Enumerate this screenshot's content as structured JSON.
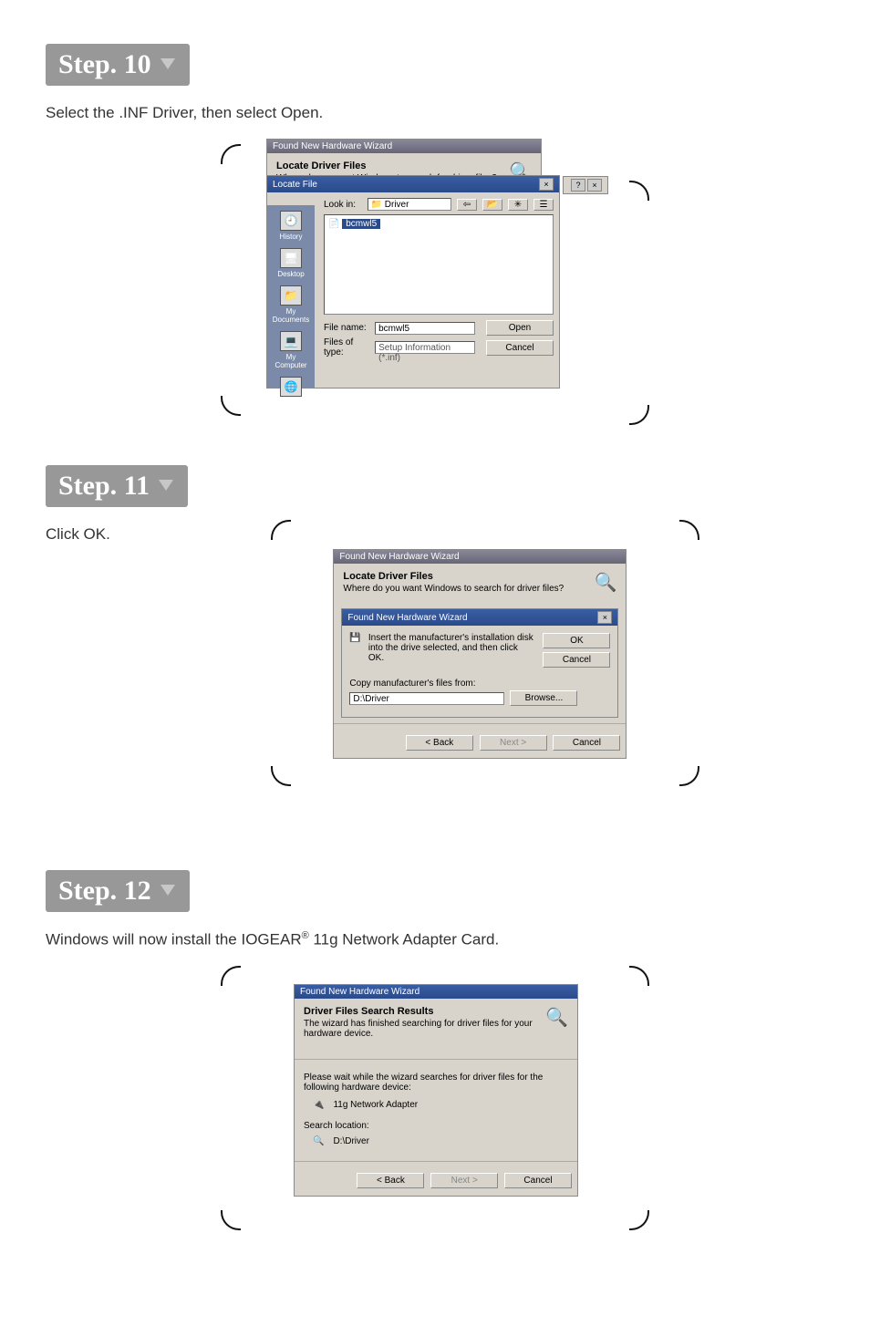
{
  "steps": {
    "s10": {
      "badge": "Step. 10",
      "intro": "Select the .INF Driver, then select Open."
    },
    "s11": {
      "badge": "Step. 11",
      "intro": "Click OK."
    },
    "s12": {
      "badge": "Step. 12",
      "intro_pre": "Windows will now install the IOGEAR",
      "intro_post": " 11g Network Adapter Card."
    }
  },
  "dlgCommon": {
    "wizardTitle": "Found New Hardware Wizard",
    "locateHeading": "Locate Driver Files",
    "locateSub": "Where do you want Windows to search for driver files?",
    "backBtn": "< Back",
    "nextBtn": "Next >",
    "cancelBtn": "Cancel"
  },
  "step10": {
    "locateFileTitle": "Locate File",
    "lookInLabel": "Look in:",
    "lookInValue": "Driver",
    "fileSelected": "bcmwl5",
    "sidebar": {
      "history": "History",
      "desktop": "Desktop",
      "mydocs": "My Documents",
      "mycomp": "My Computer",
      "mynet": "My Network P..."
    },
    "fileNameLabel": "File name:",
    "fileNameValue": "bcmwl5",
    "filesTypeLabel": "Files of type:",
    "filesTypeValue": "Setup Information (*.inf)",
    "openBtn": "Open",
    "cancelBtn": "Cancel"
  },
  "step11": {
    "innerTitle": "Found New Hardware Wizard",
    "insertText": "Insert the manufacturer's installation disk into the drive selected, and then click OK.",
    "okBtn": "OK",
    "cancelBtn": "Cancel",
    "copyLabel": "Copy manufacturer's files from:",
    "copyValue": "D:\\Driver",
    "browseBtn": "Browse..."
  },
  "step12": {
    "resultsHeading": "Driver Files Search Results",
    "resultsSub": "The wizard has finished searching for driver files for your hardware device.",
    "pleaseWait": "Please wait while the wizard searches for driver files for the following hardware device:",
    "device": "11g Network Adapter",
    "searchLocLabel": "Search location:",
    "searchLocValue": "D:\\Driver"
  }
}
